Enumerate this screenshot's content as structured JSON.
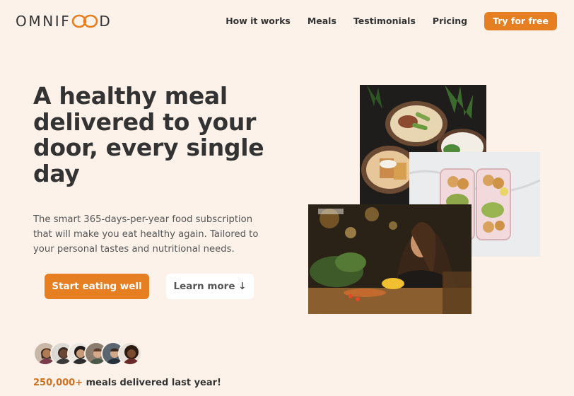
{
  "brand": {
    "logo_left": "OMNIF",
    "logo_right": "D",
    "logo_icon": "double-loop-icon",
    "accent_color": "#e67e22"
  },
  "nav": {
    "items": [
      {
        "label": "How it works"
      },
      {
        "label": "Meals"
      },
      {
        "label": "Testimonials"
      },
      {
        "label": "Pricing"
      }
    ],
    "cta_label": "Try for free"
  },
  "hero": {
    "title": "A healthy meal delivered to your door, every single day",
    "description": "The smart 365-days-per-year food subscription that will make you eat healthy again. Tailored to your personal tastes and nutritional needs.",
    "primary_button": "Start eating well",
    "secondary_button": "Learn more ↓"
  },
  "customers": {
    "count_highlight": "250,000+",
    "count_text": " meals delivered last year!",
    "avatars": [
      "customer-1",
      "customer-2",
      "customer-3",
      "customer-4",
      "customer-5",
      "customer-6"
    ]
  }
}
